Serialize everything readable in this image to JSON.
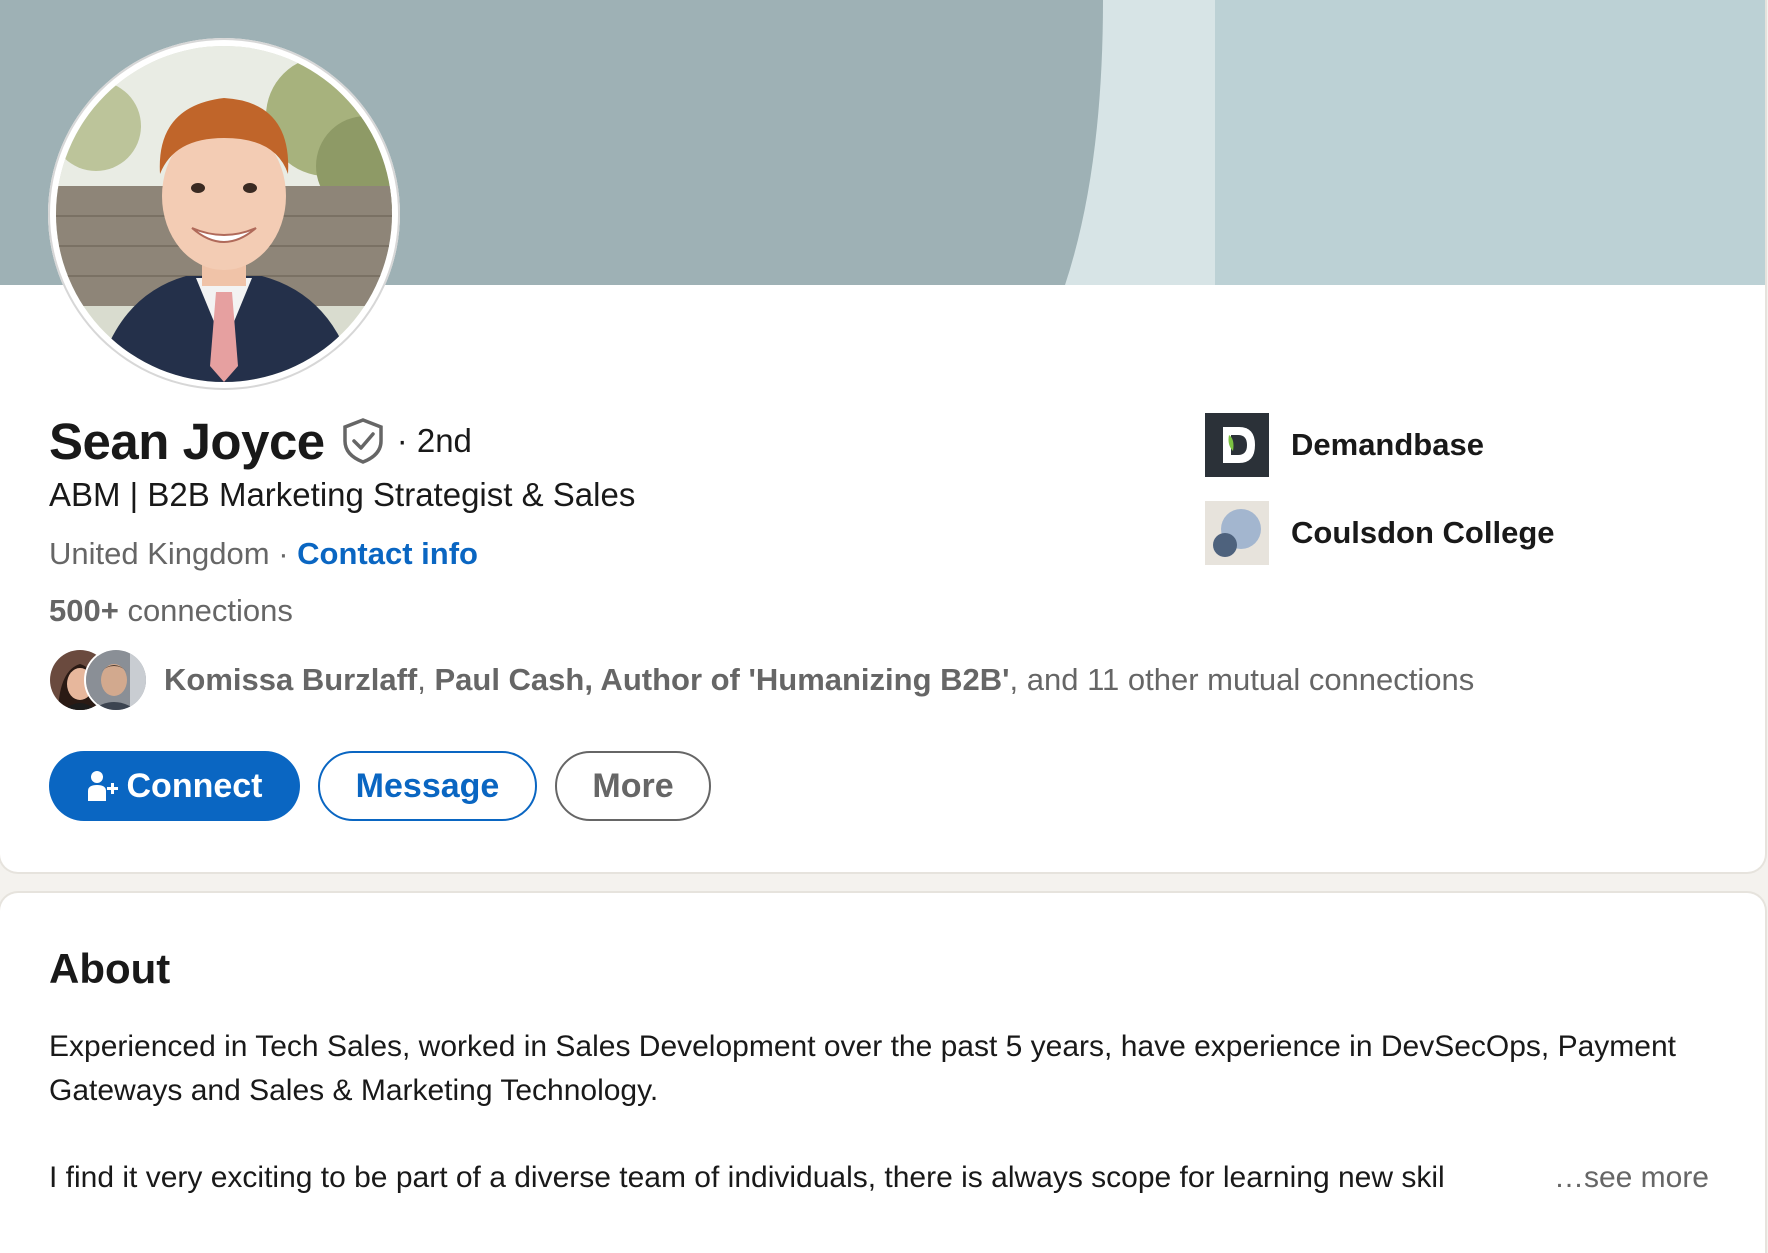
{
  "profile": {
    "name": "Sean Joyce",
    "degree": "· 2nd",
    "headline": "ABM | B2B Marketing Strategist & Sales",
    "location": "United Kingdom",
    "location_sep": " · ",
    "contact_info": "Contact info",
    "connections_count": "500+",
    "connections_label": " connections"
  },
  "mutual": {
    "name1": "Komissa Burzlaff",
    "sep1": ", ",
    "name2": "Paul Cash, Author of 'Humanizing B2B'",
    "rest": ", and 11 other mutual connections"
  },
  "actions": {
    "connect": "Connect",
    "message": "Message",
    "more": "More"
  },
  "experience": [
    {
      "label": "Demandbase",
      "icon": "demandbase-logo"
    },
    {
      "label": "Coulsdon College",
      "icon": "coulsdon-college-logo"
    }
  ],
  "about": {
    "title": "About",
    "paragraph1": "Experienced in Tech Sales, worked in Sales Development over the past 5 years, have experience in DevSecOps, Payment Gateways and Sales & Marketing Technology.",
    "paragraph2": "I find it very exciting to be part of a diverse team of individuals, there is always scope for learning new skil",
    "see_more": "…see more"
  },
  "colors": {
    "primary_blue": "#0a66c2",
    "muted_text": "#666666",
    "banner_gray": "#9eb1b5",
    "banner_light": "#bcd1d5"
  }
}
